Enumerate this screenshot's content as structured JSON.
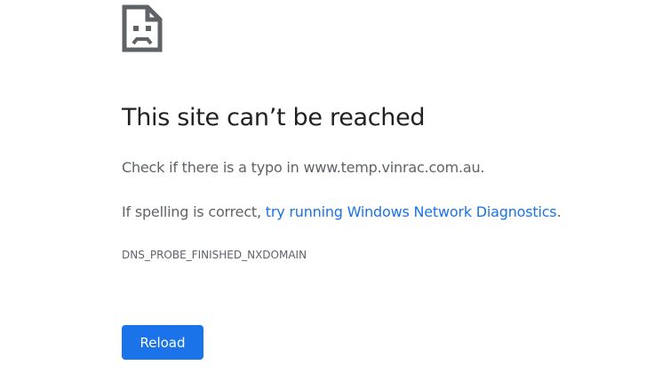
{
  "icon": "sad-page-icon",
  "headline": "This site can’t be reached",
  "typo_message": {
    "prefix": "Check if there is a typo in ",
    "domain": "www.temp.vinrac.com.au",
    "suffix": "."
  },
  "spelling_message": {
    "prefix": "If spelling is correct, ",
    "link_text": "try running Windows Network Diagnostics",
    "suffix": "."
  },
  "error_code": "DNS_PROBE_FINISHED_NXDOMAIN",
  "reload_label": "Reload",
  "colors": {
    "accent": "#1a73e8",
    "headline": "#202124",
    "body_text": "#5f6368",
    "icon": "#5f6368"
  }
}
